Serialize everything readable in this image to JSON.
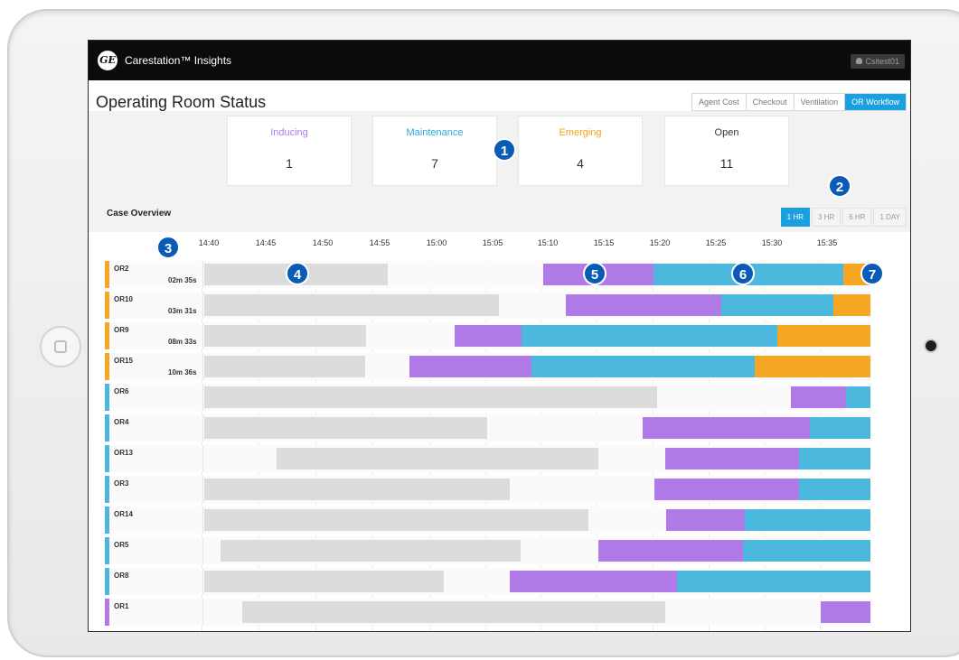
{
  "app": {
    "title": "Carestation™ Insights",
    "logo_text": "GE",
    "user": "Csitest01"
  },
  "page_title": "Operating Room Status",
  "tabs": [
    {
      "label": "Agent Cost",
      "active": false
    },
    {
      "label": "Checkout",
      "active": false
    },
    {
      "label": "Ventilation",
      "active": false
    },
    {
      "label": "OR Workflow",
      "active": true
    }
  ],
  "status_cards": [
    {
      "label": "Inducing",
      "value": "1",
      "color": "#b07be8"
    },
    {
      "label": "Maintenance",
      "value": "7",
      "color": "#2aa7dc"
    },
    {
      "label": "Emerging",
      "value": "4",
      "color": "#f2a11c"
    },
    {
      "label": "Open",
      "value": "11",
      "color": "#333333"
    }
  ],
  "case_overview": {
    "title": "Case Overview",
    "ranges": [
      {
        "label": "1 HR",
        "active": true
      },
      {
        "label": "3 HR",
        "active": false
      },
      {
        "label": "6 HR",
        "active": false
      },
      {
        "label": "1 DAY",
        "active": false
      }
    ],
    "time_labels": [
      "14:40",
      "14:45",
      "14:50",
      "14:55",
      "15:00",
      "15:05",
      "15:10",
      "15:15",
      "15:20",
      "15:25",
      "15:30",
      "15:35"
    ],
    "colors": {
      "idle": "#dcdcdc",
      "inducing": "#b07be8",
      "maintenance": "#4cb8de",
      "emerging": "#f5a623"
    },
    "rows": [
      {
        "name": "OR2",
        "duration": "02m 35s",
        "status": "emerging"
      },
      {
        "name": "OR10",
        "duration": "03m 31s",
        "status": "emerging"
      },
      {
        "name": "OR9",
        "duration": "08m 33s",
        "status": "emerging"
      },
      {
        "name": "OR15",
        "duration": "10m 36s",
        "status": "emerging"
      },
      {
        "name": "OR6",
        "duration": "",
        "status": "maintenance"
      },
      {
        "name": "OR4",
        "duration": "",
        "status": "maintenance"
      },
      {
        "name": "OR13",
        "duration": "",
        "status": "maintenance"
      },
      {
        "name": "OR3",
        "duration": "",
        "status": "maintenance"
      },
      {
        "name": "OR14",
        "duration": "",
        "status": "maintenance"
      },
      {
        "name": "OR5",
        "duration": "",
        "status": "maintenance"
      },
      {
        "name": "OR8",
        "duration": "",
        "status": "maintenance"
      },
      {
        "name": "OR1",
        "duration": "",
        "status": "inducing"
      }
    ]
  },
  "callouts": [
    "1",
    "2",
    "3",
    "4",
    "5",
    "6",
    "7"
  ]
}
